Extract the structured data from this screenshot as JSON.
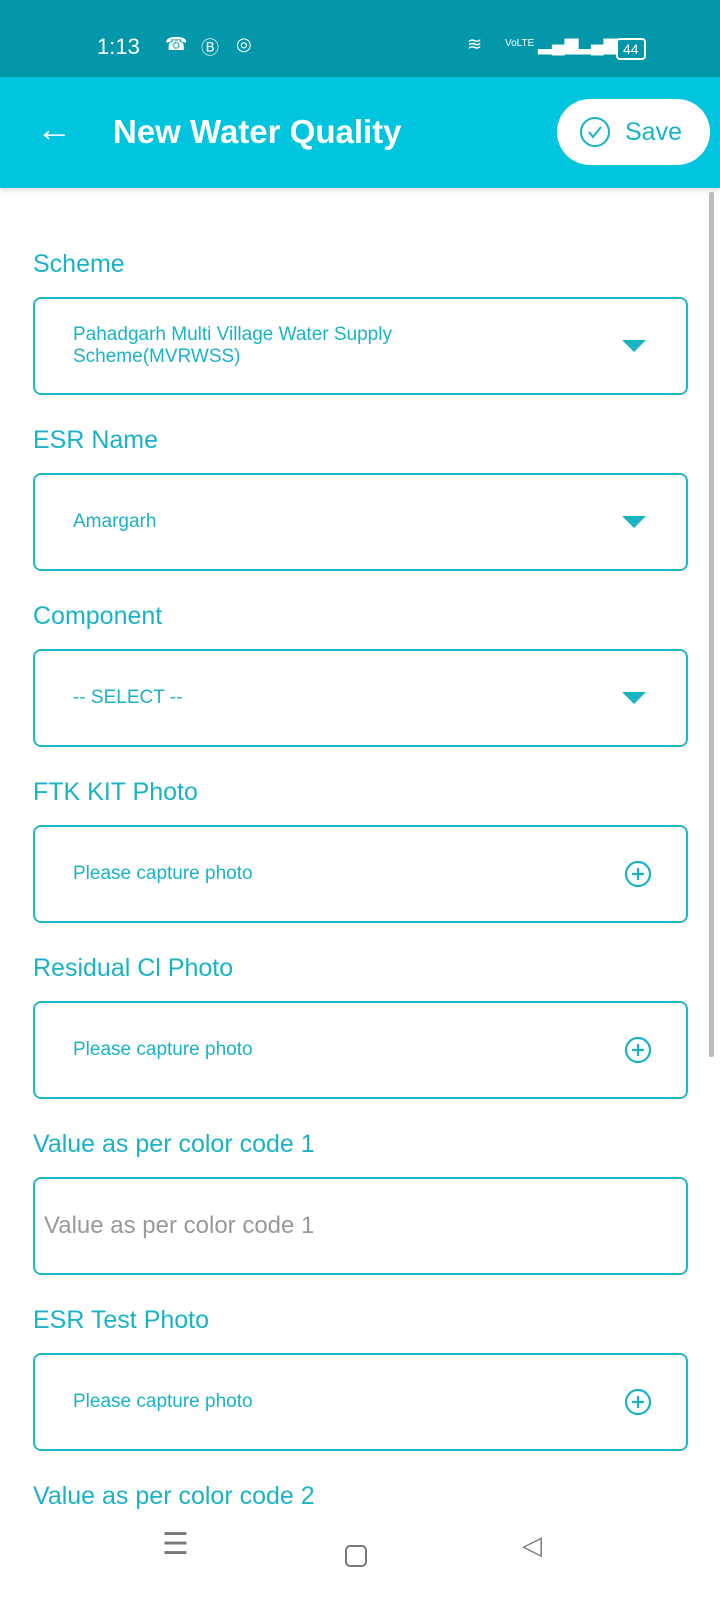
{
  "status_bar": {
    "time": "1:13",
    "battery": "44",
    "network": "VoLTE"
  },
  "header": {
    "title": "New Water Quality",
    "save_label": "Save"
  },
  "fields": [
    {
      "label": "Scheme",
      "value": "Pahadgarh Multi Village Water Supply Scheme(MVRWSS)",
      "type": "dropdown"
    },
    {
      "label": "ESR Name",
      "value": "Amargarh",
      "type": "dropdown"
    },
    {
      "label": "Component",
      "value": "-- SELECT --",
      "type": "dropdown"
    },
    {
      "label": "FTK KIT Photo",
      "value": "Please capture photo",
      "type": "photo"
    },
    {
      "label": "Residual Cl Photo",
      "value": "Please capture photo",
      "type": "photo"
    },
    {
      "label": "Value as per color code 1",
      "placeholder": "Value as per color code 1",
      "type": "input"
    },
    {
      "label": "ESR Test Photo",
      "value": "Please capture photo",
      "type": "photo"
    },
    {
      "label": "Value as per color code 2",
      "type": "input"
    }
  ],
  "colors": {
    "status_bar": "#0397a9",
    "app_bar": "#01c4de",
    "accent": "#1ab3c6"
  }
}
